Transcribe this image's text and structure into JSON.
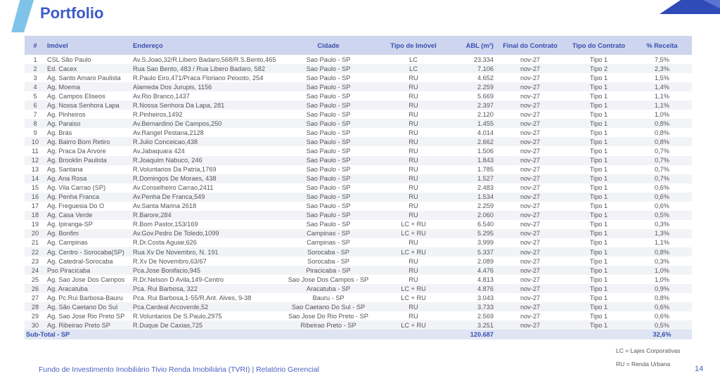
{
  "page": {
    "title": "Portfolio",
    "footer": "Fundo de Investimento Imobiliário Tivio Renda Imobiliária (TVRI) | Relatório Gerencial",
    "page_number": "14",
    "accent_color": "#3b5bc8",
    "header_bg": "#cdd6ee"
  },
  "table": {
    "headers": [
      "#",
      "Imóvel",
      "Endereço",
      "Cidade",
      "Tipo de Imóvel",
      "ABL (m²)",
      "Final do Contrato",
      "Tipo do Contrato",
      "% Receita"
    ],
    "rows": [
      [
        "1",
        "CSL São Paulo",
        "Av.S.Joao,32/R.Libero Badaro,568/R.S.Bento,465",
        "Sao Paulo - SP",
        "LC",
        "23.334",
        "nov-27",
        "Tipo 1",
        "7,5%"
      ],
      [
        "2",
        "Ed. Cacex",
        "Rua Sao Bento, 483 / Rua Libero Badaro, 582",
        "Sao Paulo - SP",
        "LC",
        "7.106",
        "nov-27",
        "Tipo 2",
        "2,3%"
      ],
      [
        "3",
        "Ag. Santo Amaro Paulista",
        "R.Paulo Eiro,471/Praca Floriano Peixoto, 254",
        "Sao Paulo - SP",
        "RU",
        "4.652",
        "nov-27",
        "Tipo 1",
        "1,5%"
      ],
      [
        "4",
        "Ag. Moema",
        "Alameda Dos Jurupis, 1156",
        "Sao Paulo - SP",
        "RU",
        "2.259",
        "nov-27",
        "Tipo 1",
        "1,4%"
      ],
      [
        "5",
        "Ag. Campos Eliseos",
        "Av.Rio Branco,1437",
        "Sao Paulo - SP",
        "RU",
        "5.669",
        "nov-27",
        "Tipo 1",
        "1,1%"
      ],
      [
        "6",
        "Ag. Nossa Senhora Lapa",
        "R.Nossa Senhora Da Lapa, 281",
        "Sao Paulo - SP",
        "RU",
        "2.397",
        "nov-27",
        "Tipo 1",
        "1,1%"
      ],
      [
        "7",
        "Ag. Pinheiros",
        "R.Pinheiros,1492",
        "Sao Paulo - SP",
        "RU",
        "2.120",
        "nov-27",
        "Tipo 1",
        "1,0%"
      ],
      [
        "8",
        "Ag. Paraiso",
        "Av.Bernardino De Campos,250",
        "Sao Paulo - SP",
        "RU",
        "1.455",
        "nov-27",
        "Tipo 1",
        "0,8%"
      ],
      [
        "9",
        "Ag. Brás",
        "Av.Rangel Pestana,2128",
        "Sao Paulo - SP",
        "RU",
        "4.014",
        "nov-27",
        "Tipo 1",
        "0,8%"
      ],
      [
        "10",
        "Ag. Bairro Bom Retiro",
        "R.Julio Conceicao,438",
        "Sao Paulo - SP",
        "RU",
        "2.662",
        "nov-27",
        "Tipo 1",
        "0,8%"
      ],
      [
        "11",
        "Ag. Praca Da Arvore",
        "Av.Jabaquara 424",
        "Sao Paulo - SP",
        "RU",
        "1.506",
        "nov-27",
        "Tipo 1",
        "0,7%"
      ],
      [
        "12",
        "Ag. Brooklin Paulista",
        "R.Joaquim Nabuco, 246",
        "Sao Paulo - SP",
        "RU",
        "1.843",
        "nov-27",
        "Tipo 1",
        "0,7%"
      ],
      [
        "13",
        "Ag. Santana",
        "R.Voluntarios Da Patria,1769",
        "Sao Paulo - SP",
        "RU",
        "1.785",
        "nov-27",
        "Tipo 1",
        "0,7%"
      ],
      [
        "14",
        "Ag. Ana Rosa",
        "R.Domingos De Moraes, 438",
        "Sao Paulo - SP",
        "RU",
        "1.527",
        "nov-27",
        "Tipo 1",
        "0,7%"
      ],
      [
        "15",
        "Ag. Vila Carrao (SP)",
        "Av.Conselheiro Carrao,2411",
        "Sao Paulo - SP",
        "RU",
        "2.483",
        "nov-27",
        "Tipo 1",
        "0,6%"
      ],
      [
        "16",
        "Ag. Penha Franca",
        "Av.Penha De Franca,549",
        "Sao Paulo - SP",
        "RU",
        "1.534",
        "nov-27",
        "Tipo 1",
        "0,6%"
      ],
      [
        "17",
        "Ag. Freguesia Do O",
        "Av.Santa Marina 2618",
        "Sao Paulo - SP",
        "RU",
        "2.259",
        "nov-27",
        "Tipo 1",
        "0,6%"
      ],
      [
        "18",
        "Ag. Casa Verde",
        "R.Barore,284",
        "Sao Paulo - SP",
        "RU",
        "2.060",
        "nov-27",
        "Tipo 1",
        "0,5%"
      ],
      [
        "19",
        "Ag. Ipiranga-SP",
        "R.Bom Pastor,153/169",
        "Sao Paulo - SP",
        "LC + RU",
        "6.540",
        "nov-27",
        "Tipo 1",
        "0,3%"
      ],
      [
        "20",
        "Ag. Bonfim",
        "Av.Gov.Pedro De Toledo,1099",
        "Campinas - SP",
        "LC + RU",
        "5.295",
        "nov-27",
        "Tipo 1",
        "1,3%"
      ],
      [
        "21",
        "Ag. Campinas",
        "R.Dr.Costa Aguiar,626",
        "Campinas - SP",
        "RU",
        "3.999",
        "nov-27",
        "Tipo 1",
        "1,1%"
      ],
      [
        "22",
        "Ag. Centro - Sorocaba(SP)",
        "Rua Xv De Novembro, N. 191",
        "Sorocaba - SP",
        "LC + RU",
        "5.337",
        "nov-27",
        "Tipo 1",
        "0,8%"
      ],
      [
        "23",
        "Ag. Catedral-Sorocaba",
        "R.Xv De Novembro,63/67",
        "Sorocaba - SP",
        "RU",
        "2.089",
        "nov-27",
        "Tipo 1",
        "0,3%"
      ],
      [
        "24",
        "Pso Piracicaba",
        "Pca.Jose Bonifacio,945",
        "Piracicaba - SP",
        "RU",
        "4.476",
        "nov-27",
        "Tipo 1",
        "1,0%"
      ],
      [
        "25",
        "Ag. Sao Jose Dos Campos",
        "R.Dr.Nelson D Avila,149-Centro",
        "Sao Jose Dos Campos - SP",
        "RU",
        "4.813",
        "nov-27",
        "Tipo 1",
        "1,0%"
      ],
      [
        "26",
        "Ag. Aracatuba",
        "Pca. Rui Barbosa, 322",
        "Aracatuba - SP",
        "LC + RU",
        "4.876",
        "nov-27",
        "Tipo 1",
        "0,9%"
      ],
      [
        "27",
        "Ag. Pc.Rui Barbosa-Bauru",
        "Pca. Rui Barbosa,1-55/R.Ant. Alves, 9-38",
        "Bauru - SP",
        "LC + RU",
        "3.043",
        "nov-27",
        "Tipo 1",
        "0,8%"
      ],
      [
        "28",
        "Ag. São Caetano Do Sul",
        "Pca.Cardeal Arcoverde,52",
        "Sao Caetano Do Sul - SP",
        "RU",
        "3.733",
        "nov-27",
        "Tipo 1",
        "0,6%"
      ],
      [
        "29",
        "Ag. Sao Jose Rio Preto SP",
        "R.Voluntarios De S.Paulo,2975",
        "Sao Jose Do Rio Preto - SP",
        "RU",
        "2.569",
        "nov-27",
        "Tipo 1",
        "0,6%"
      ],
      [
        "30",
        "Ag. Ribeirao Preto SP",
        "R.Duque De Caxias,725",
        "Ribeirao Preto - SP",
        "LC + RU",
        "3.251",
        "nov-27",
        "Tipo 1",
        "0,5%"
      ]
    ],
    "subtotal": {
      "label": "Sub-Total - SP",
      "abl": "120.687",
      "receita": "32,6%"
    }
  },
  "legend": {
    "lc": "LC = Lajes Corporativas",
    "ru": "RU = Renda Urbana"
  }
}
